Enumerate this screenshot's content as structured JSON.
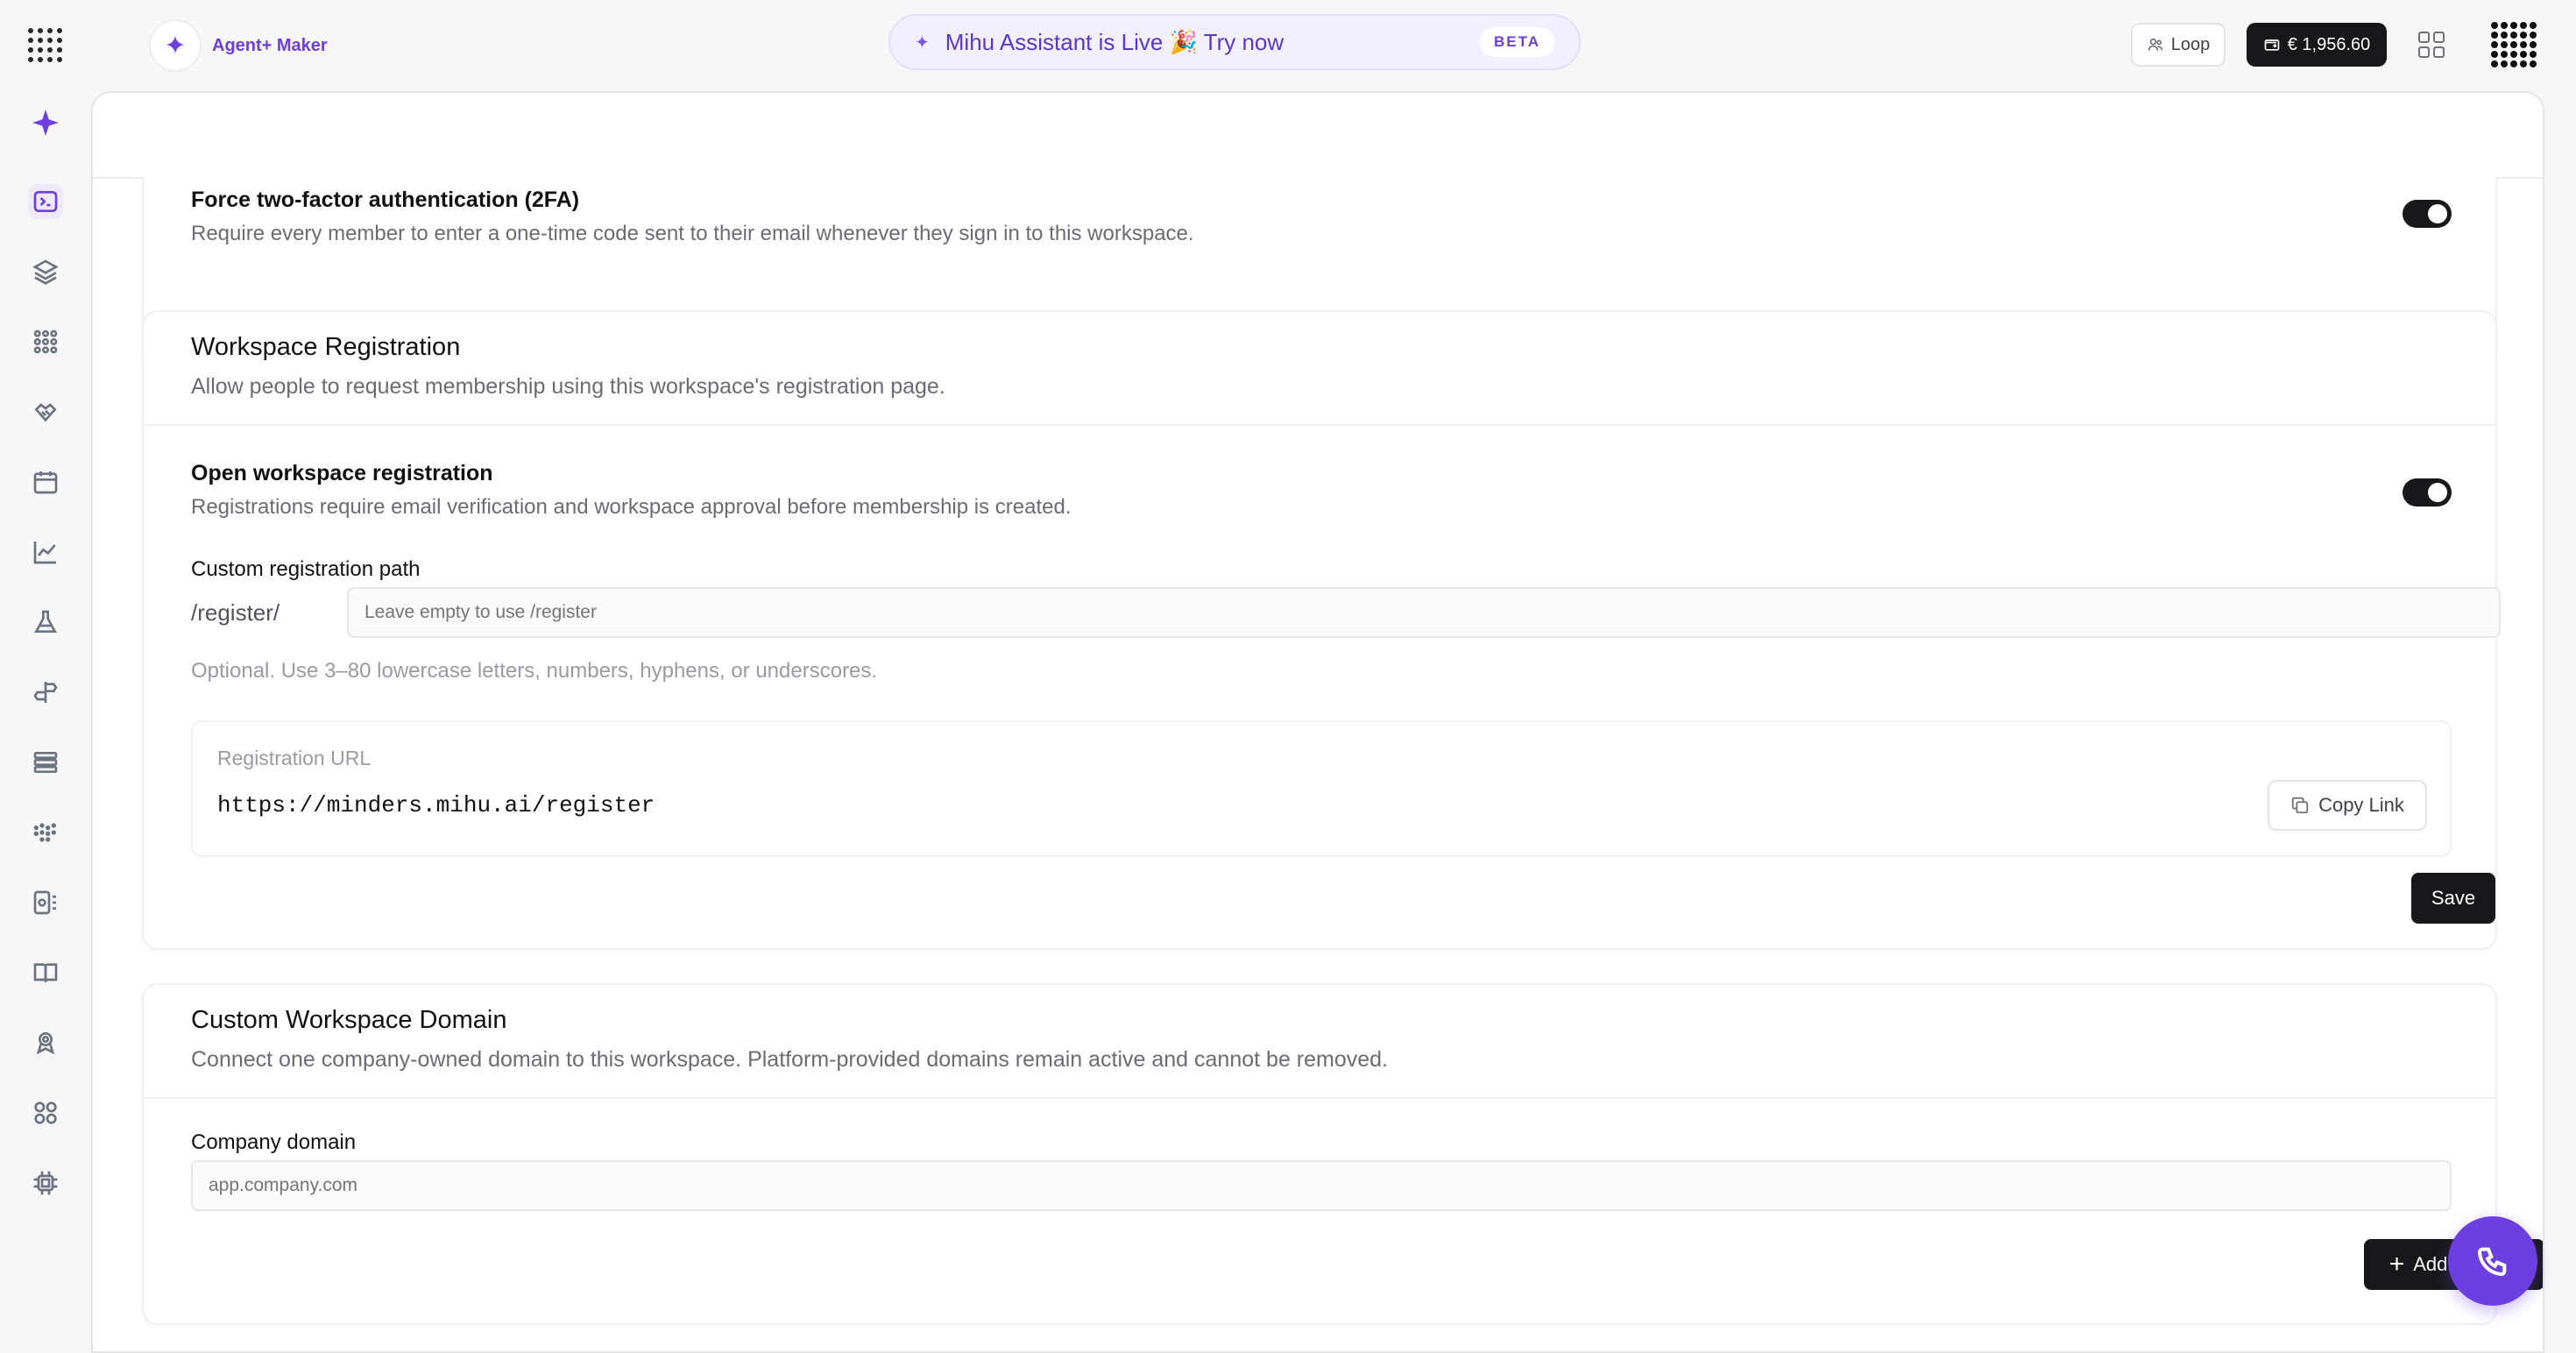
{
  "topbar": {
    "brand_name": "Agent+ Maker",
    "banner_text": "Mihu Assistant is Live 🎉 Try now",
    "banner_badge": "BETA",
    "loop_label": "Loop",
    "balance_label": "€ 1,956.60"
  },
  "sidebar": {
    "items": [
      "sparkle-icon",
      "terminal-icon",
      "layers-icon",
      "grid-icon",
      "handshake-icon",
      "calendar-icon",
      "chart-line-icon",
      "flask-icon",
      "signpost-icon",
      "list-icon",
      "dots-grid-icon",
      "device-icon",
      "book-icon",
      "user-badge-icon",
      "components-icon",
      "chip-icon"
    ]
  },
  "two_factor": {
    "title": "Force two-factor authentication (2FA)",
    "description": "Require every member to enter a one-time code sent to their email whenever they sign in to this workspace.",
    "enabled": true
  },
  "registration": {
    "title": "Workspace Registration",
    "description": "Allow people to request membership using this workspace's registration page.",
    "open_title": "Open workspace registration",
    "open_description": "Registrations require email verification and workspace approval before membership is created.",
    "open_enabled": true,
    "path_label": "Custom registration path",
    "path_prefix": "/register/",
    "path_placeholder": "Leave empty to use /register",
    "path_hint": "Optional. Use 3–80 lowercase letters, numbers, hyphens, or underscores.",
    "url_label": "Registration URL",
    "url_value": "https://minders.mihu.ai/register",
    "copy_label": "Copy Link",
    "save_label": "Save"
  },
  "domain": {
    "title": "Custom Workspace Domain",
    "description": "Connect one company-owned domain to this workspace. Platform-provided domains remain active and cannot be removed.",
    "field_label": "Company domain",
    "placeholder": "app.company.com",
    "add_label": "Add Domain"
  },
  "colors": {
    "accent": "#6d3fe0",
    "dark": "#18181b"
  }
}
